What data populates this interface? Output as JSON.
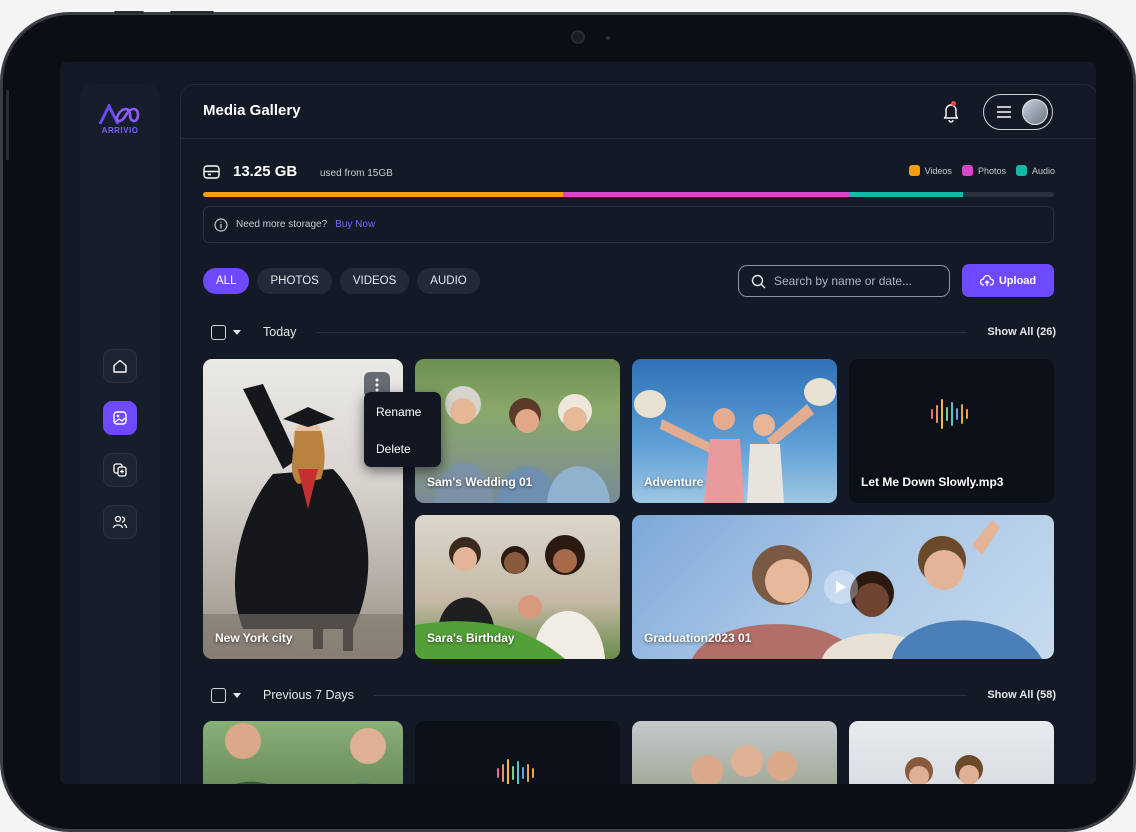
{
  "header": {
    "title": "Media Gallery"
  },
  "storage": {
    "used": "13.25 GB",
    "suffix": "used from 15GB"
  },
  "legend": [
    {
      "label": "Videos",
      "color": "#f59e0b"
    },
    {
      "label": "Photos",
      "color": "#d946c9"
    },
    {
      "label": "Audio",
      "color": "#14b8a6"
    }
  ],
  "storage_bar": {
    "videos_pct": 42.3,
    "photos_pct": 33.7,
    "audio_pct": 13.3
  },
  "notice": {
    "text": "Need more storage?",
    "link": "Buy Now"
  },
  "filters": {
    "all": "ALL",
    "photos": "PHOTOS",
    "videos": "VIDEOS",
    "audio": "AUDIO"
  },
  "search": {
    "placeholder": "Search by name or date..."
  },
  "upload_label": "Upload",
  "sections": {
    "today": {
      "title": "Today",
      "show_all": "Show All (26)"
    },
    "previous": {
      "title": "Previous 7 Days",
      "show_all": "Show All (58)"
    }
  },
  "context_menu": {
    "rename": "Rename",
    "delete": "Delete"
  },
  "tiles": {
    "t1": "New York city",
    "t2": "Sam's Wedding 01",
    "t3": "Adventure",
    "t4": "Let Me Down Slowly.mp3",
    "t5": "Sara's Birthday",
    "t6": "Graduation2023 01"
  },
  "logo_text": "ARRIVIO"
}
